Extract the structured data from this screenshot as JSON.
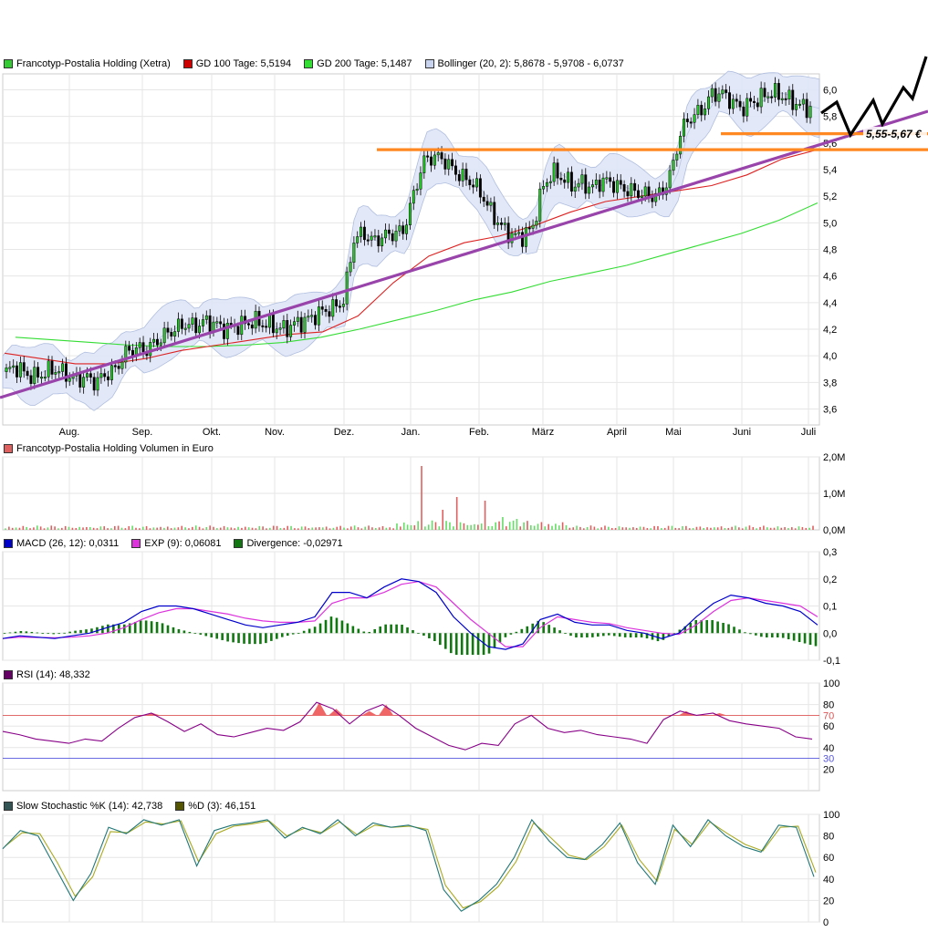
{
  "chart_data": [
    {
      "type": "candlestick",
      "panel": "price",
      "legend": [
        {
          "label": "Francotyp-Postalia Holding (Xetra)",
          "color": "#33cc33"
        },
        {
          "label": "GD 100 Tage: 5,5194",
          "color": "#cc0000"
        },
        {
          "label": "GD 200 Tage: 5,1487",
          "color": "#33dd33"
        },
        {
          "label": "Bollinger (20, 2): 5,8678 - 5,9708 - 6,0737",
          "color": "#c8d4ef"
        }
      ],
      "x_tick_labels": [
        "Aug.",
        "Sep.",
        "Okt.",
        "Nov.",
        "Dez.",
        "Jan.",
        "Feb.",
        "März",
        "April",
        "Mai",
        "Juni",
        "Juli"
      ],
      "y_tick_labels": [
        "3,6",
        "3,8",
        "4,0",
        "4,2",
        "4,4",
        "4,6",
        "4,8",
        "5,0",
        "5,2",
        "5,4",
        "5,6",
        "5,8",
        "6,0"
      ],
      "ylim": [
        3.48,
        6.12
      ],
      "annotation_text": "5,55-5,67 €",
      "support_levels": [
        5.55,
        5.67
      ],
      "close_series": [
        3.88,
        3.92,
        3.86,
        3.84,
        3.88,
        3.9,
        3.86,
        3.82,
        3.84,
        3.8,
        3.86,
        3.9,
        4.02,
        4.06,
        4.04,
        4.1,
        4.16,
        4.2,
        4.24,
        4.22,
        4.26,
        4.24,
        4.2,
        4.22,
        4.24,
        4.26,
        4.24,
        4.22,
        4.2,
        4.24,
        4.26,
        4.3,
        4.34,
        4.36,
        4.42,
        4.88,
        4.92,
        4.86,
        4.9,
        4.92,
        4.94,
        5.2,
        5.46,
        5.5,
        5.48,
        5.4,
        5.34,
        5.3,
        5.2,
        5.06,
        4.96,
        4.9,
        4.9,
        4.96,
        5.26,
        5.38,
        5.34,
        5.28,
        5.3,
        5.26,
        5.32,
        5.3,
        5.26,
        5.24,
        5.22,
        5.2,
        5.22,
        5.38,
        5.7,
        5.8,
        5.84,
        5.96,
        5.98,
        5.92,
        5.86,
        5.9,
        5.94,
        5.98,
        5.96,
        5.92,
        5.88,
        5.86
      ]
    },
    {
      "type": "bar",
      "panel": "volume",
      "legend": [
        {
          "label": "Francotyp-Postalia Holding Volumen in Euro",
          "color": "#e06060"
        }
      ],
      "y_tick_labels": [
        "2,0M",
        "1,0M",
        "0,0M"
      ],
      "ylim": [
        0,
        2.0
      ],
      "spike_values": [
        1.75,
        0.9,
        0.8,
        0.55,
        0.35,
        0.3
      ]
    },
    {
      "type": "line",
      "panel": "macd",
      "legend": [
        {
          "label": "MACD (26, 12): 0,0311",
          "color": "#0000cc"
        },
        {
          "label": "EXP (9): 0,06081",
          "color": "#dd33dd"
        },
        {
          "label": "Divergence: -0,02971",
          "color": "#117711"
        }
      ],
      "y_tick_labels": [
        "0,3",
        "0,2",
        "0,1",
        "0,0",
        "-0,1"
      ],
      "ylim": [
        -0.1,
        0.3
      ],
      "macd": [
        -0.02,
        -0.01,
        -0.015,
        -0.02,
        -0.01,
        0.0,
        0.02,
        0.04,
        0.08,
        0.1,
        0.1,
        0.09,
        0.07,
        0.05,
        0.03,
        0.02,
        0.03,
        0.04,
        0.06,
        0.15,
        0.15,
        0.13,
        0.17,
        0.2,
        0.19,
        0.15,
        0.06,
        0.0,
        -0.05,
        -0.06,
        -0.04,
        0.05,
        0.07,
        0.04,
        0.03,
        0.03,
        0.01,
        0.0,
        -0.02,
        0.0,
        0.06,
        0.11,
        0.14,
        0.13,
        0.11,
        0.1,
        0.08,
        0.03
      ],
      "signal": [
        -0.02,
        -0.015,
        -0.016,
        -0.017,
        -0.015,
        -0.01,
        0.0,
        0.02,
        0.05,
        0.075,
        0.09,
        0.09,
        0.08,
        0.07,
        0.055,
        0.045,
        0.04,
        0.04,
        0.045,
        0.11,
        0.13,
        0.13,
        0.15,
        0.18,
        0.19,
        0.17,
        0.11,
        0.05,
        0.0,
        -0.05,
        -0.05,
        0.02,
        0.06,
        0.05,
        0.04,
        0.035,
        0.02,
        0.01,
        0.0,
        -0.005,
        0.03,
        0.08,
        0.12,
        0.13,
        0.12,
        0.11,
        0.1,
        0.06
      ]
    },
    {
      "type": "line",
      "panel": "rsi",
      "legend": [
        {
          "label": "RSI (14): 48,332",
          "color": "#660066"
        }
      ],
      "y_tick_labels": [
        "100",
        "80",
        "60",
        "40",
        "20"
      ],
      "level_labels": [
        "70",
        "30"
      ],
      "ylim": [
        0,
        100
      ],
      "values": [
        55,
        52,
        48,
        46,
        44,
        48,
        46,
        58,
        68,
        72,
        64,
        55,
        62,
        52,
        50,
        54,
        58,
        56,
        64,
        82,
        76,
        62,
        74,
        80,
        70,
        58,
        50,
        42,
        38,
        44,
        42,
        62,
        70,
        58,
        54,
        56,
        52,
        50,
        48,
        44,
        66,
        74,
        70,
        72,
        65,
        62,
        60,
        58,
        50,
        48
      ]
    },
    {
      "type": "line",
      "panel": "stochastic",
      "legend": [
        {
          "label": "Slow Stochastic %K (14): 42,738",
          "color": "#335555"
        },
        {
          "label": "%D (3): 46,151",
          "color": "#555500"
        }
      ],
      "y_tick_labels": [
        "100",
        "80",
        "60",
        "40",
        "20",
        "0"
      ],
      "ylim": [
        0,
        100
      ],
      "k": [
        68,
        85,
        80,
        50,
        20,
        45,
        88,
        82,
        95,
        90,
        95,
        52,
        85,
        90,
        92,
        95,
        78,
        88,
        82,
        95,
        80,
        92,
        88,
        90,
        85,
        30,
        10,
        20,
        35,
        60,
        95,
        75,
        60,
        58,
        72,
        92,
        55,
        35,
        90,
        70,
        95,
        80,
        70,
        65,
        90,
        88,
        42
      ],
      "d": [
        70,
        83,
        82,
        55,
        24,
        42,
        84,
        83,
        93,
        91,
        94,
        56,
        82,
        89,
        91,
        94,
        80,
        87,
        83,
        93,
        81,
        90,
        88,
        89,
        86,
        34,
        13,
        19,
        33,
        56,
        92,
        78,
        62,
        58,
        70,
        90,
        58,
        38,
        86,
        72,
        93,
        82,
        72,
        66,
        88,
        89,
        46
      ]
    }
  ]
}
